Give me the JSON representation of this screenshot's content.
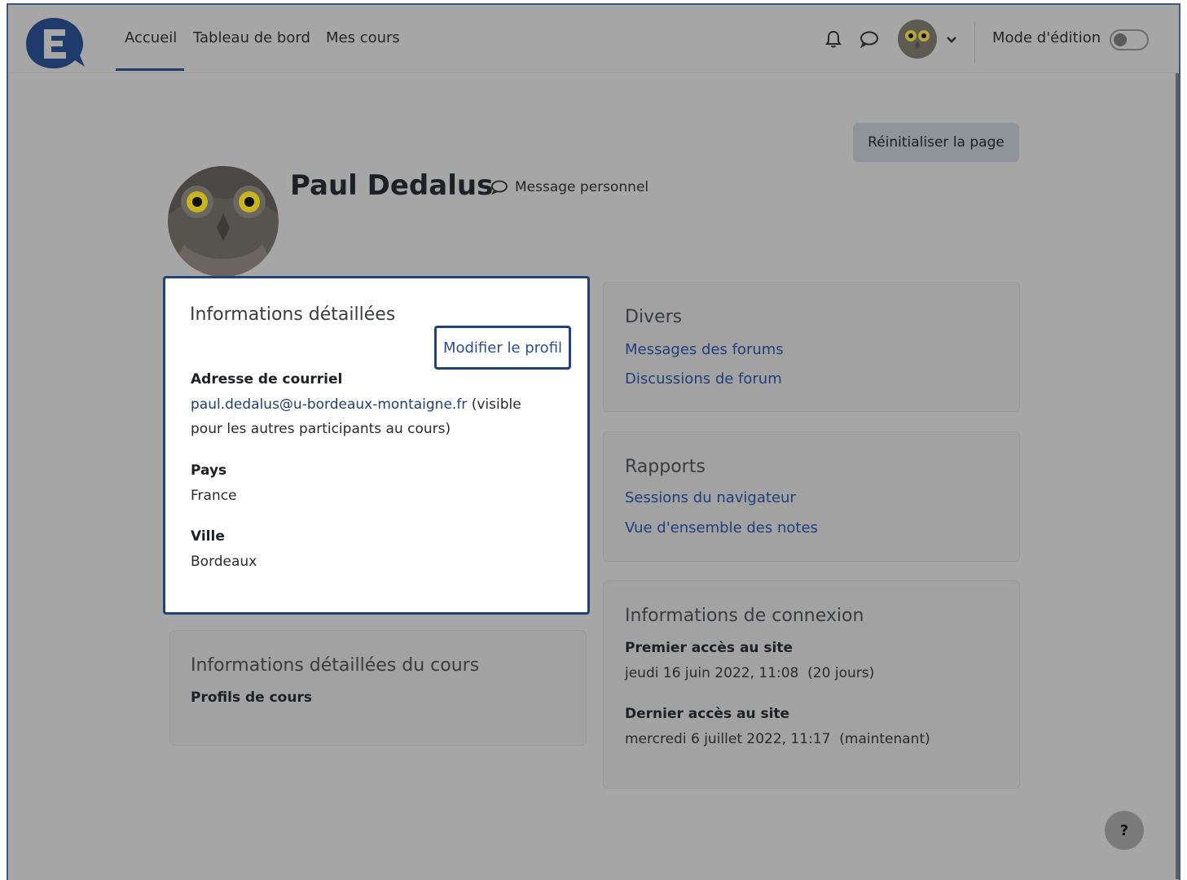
{
  "nav": {
    "links": [
      "Accueil",
      "Tableau de bord",
      "Mes cours"
    ],
    "edit_mode_label": "Mode d'édition"
  },
  "page": {
    "reset_button": "Réinitialiser la page",
    "user_name": "Paul Dedalus",
    "message_link": "Message personnel"
  },
  "details_card": {
    "title": "Informations détaillées",
    "edit_button": "Modifier le profil",
    "email_label": "Adresse de courriel",
    "email_value": "paul.dedalus@u-bordeaux-montaigne.fr",
    "email_note_1": " (visible",
    "email_note_2": "pour les autres participants au cours)",
    "country_label": "Pays",
    "country_value": "France",
    "city_label": "Ville",
    "city_value": "Bordeaux"
  },
  "course_card": {
    "title": "Informations détaillées du cours",
    "profiles_label": "Profils de cours"
  },
  "misc_card": {
    "title": "Divers",
    "links": [
      "Messages des forums",
      "Discussions de forum"
    ]
  },
  "reports_card": {
    "title": "Rapports",
    "links": [
      "Sessions du navigateur",
      "Vue d'ensemble des notes"
    ]
  },
  "login_card": {
    "title": "Informations de connexion",
    "first_access_label": "Premier accès au site",
    "first_access_value": "jeudi 16 juin 2022, 11:08  (20 jours)",
    "last_access_label": "Dernier accès au site",
    "last_access_value": "mercredi 6 juillet 2022, 11:17  (maintenant)"
  },
  "help_button": "?"
}
